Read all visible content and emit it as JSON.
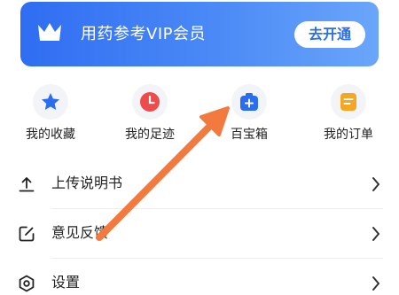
{
  "vip_banner": {
    "icon": "crown-icon",
    "title": "用药参考VIP会员",
    "button_label": "去开通",
    "gradient_start": "#2f6df2",
    "gradient_end": "#6aa6fa"
  },
  "quick_actions": [
    {
      "label": "我的收藏",
      "icon": "star-icon",
      "color": "#2a6df0"
    },
    {
      "label": "我的足迹",
      "icon": "clock-icon",
      "color": "#ef4b4b"
    },
    {
      "label": "百宝箱",
      "icon": "toolbox-plus-icon",
      "color": "#2a6df0"
    },
    {
      "label": "我的订单",
      "icon": "order-list-icon",
      "color": "#f5a623"
    }
  ],
  "list_items": [
    {
      "label": "上传说明书",
      "icon": "upload-icon"
    },
    {
      "label": "意见反馈",
      "icon": "edit-feedback-icon"
    },
    {
      "label": "设置",
      "icon": "settings-icon"
    }
  ],
  "annotation": {
    "type": "arrow",
    "color": "#f27a3f",
    "points_to": "百宝箱"
  }
}
